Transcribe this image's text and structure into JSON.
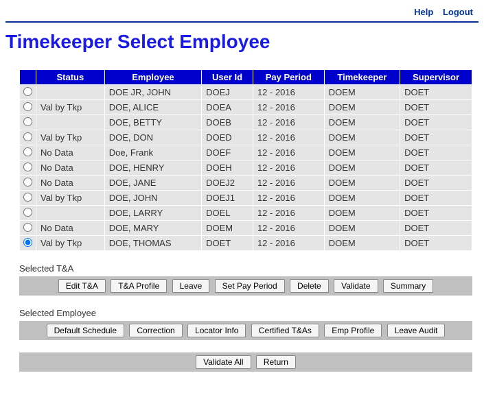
{
  "header": {
    "help": "Help",
    "logout": "Logout"
  },
  "page_title": "Timekeeper Select Employee",
  "table": {
    "headers": {
      "status": "Status",
      "employee": "Employee",
      "user_id": "User Id",
      "pay_period": "Pay Period",
      "timekeeper": "Timekeeper",
      "supervisor": "Supervisor"
    },
    "rows": [
      {
        "selected": false,
        "status": "",
        "employee": "DOE JR, JOHN",
        "user_id": "DOEJ",
        "pay_period": "12 - 2016",
        "timekeeper": "DOEM",
        "supervisor": "DOET"
      },
      {
        "selected": false,
        "status": "Val by Tkp",
        "employee": "DOE, ALICE",
        "user_id": "DOEA",
        "pay_period": "12 - 2016",
        "timekeeper": "DOEM",
        "supervisor": "DOET"
      },
      {
        "selected": false,
        "status": "",
        "employee": "DOE, BETTY",
        "user_id": "DOEB",
        "pay_period": "12 - 2016",
        "timekeeper": "DOEM",
        "supervisor": "DOET"
      },
      {
        "selected": false,
        "status": "Val by Tkp",
        "employee": "DOE, DON",
        "user_id": "DOED",
        "pay_period": "12 - 2016",
        "timekeeper": "DOEM",
        "supervisor": "DOET"
      },
      {
        "selected": false,
        "status": "No Data",
        "employee": "Doe, Frank",
        "user_id": "DOEF",
        "pay_period": "12 - 2016",
        "timekeeper": "DOEM",
        "supervisor": "DOET"
      },
      {
        "selected": false,
        "status": "No Data",
        "employee": "DOE, HENRY",
        "user_id": "DOEH",
        "pay_period": "12 - 2016",
        "timekeeper": "DOEM",
        "supervisor": "DOET"
      },
      {
        "selected": false,
        "status": "No Data",
        "employee": "DOE, JANE",
        "user_id": "DOEJ2",
        "pay_period": "12 - 2016",
        "timekeeper": "DOEM",
        "supervisor": "DOET"
      },
      {
        "selected": false,
        "status": "Val by Tkp",
        "employee": "DOE, JOHN",
        "user_id": "DOEJ1",
        "pay_period": "12 - 2016",
        "timekeeper": "DOEM",
        "supervisor": "DOET"
      },
      {
        "selected": false,
        "status": "",
        "employee": "DOE, LARRY",
        "user_id": "DOEL",
        "pay_period": "12 - 2016",
        "timekeeper": "DOEM",
        "supervisor": "DOET"
      },
      {
        "selected": false,
        "status": "No Data",
        "employee": "DOE, MARY",
        "user_id": "DOEM",
        "pay_period": "12 - 2016",
        "timekeeper": "DOEM",
        "supervisor": "DOET"
      },
      {
        "selected": true,
        "status": "Val by Tkp",
        "employee": "DOE, THOMAS",
        "user_id": "DOET",
        "pay_period": "12 - 2016",
        "timekeeper": "DOEM",
        "supervisor": "DOET"
      }
    ]
  },
  "sections": {
    "ta_label": "Selected T&A",
    "ta_buttons": {
      "edit_ta": "Edit T&A",
      "ta_profile": "T&A Profile",
      "leave": "Leave",
      "set_pay_period": "Set Pay Period",
      "delete": "Delete",
      "validate": "Validate",
      "summary": "Summary"
    },
    "emp_label": "Selected Employee",
    "emp_buttons": {
      "default_schedule": "Default Schedule",
      "correction": "Correction",
      "locator_info": "Locator Info",
      "certified_tas": "Certified T&As",
      "emp_profile": "Emp Profile",
      "leave_audit": "Leave Audit"
    },
    "bottom_buttons": {
      "validate_all": "Validate All",
      "return": "Return"
    }
  }
}
